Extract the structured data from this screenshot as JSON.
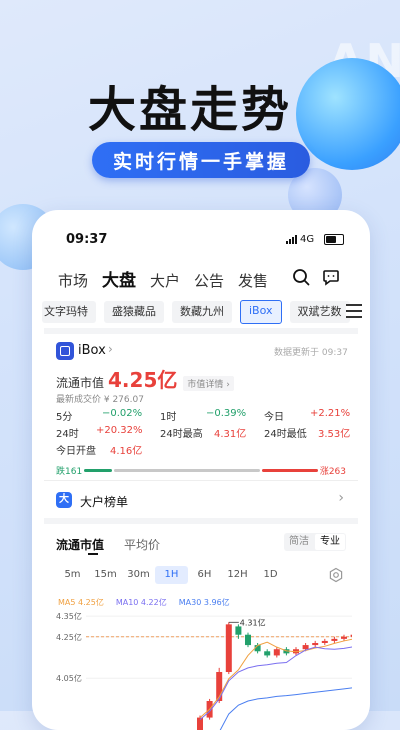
{
  "promo": {
    "headline": "大盘走势",
    "subhead": "实时行情一手掌握",
    "watermark": "AN"
  },
  "status_bar": {
    "time": "09:37",
    "network": "4G"
  },
  "top_nav": {
    "tabs": [
      "市场",
      "大盘",
      "大户",
      "公告",
      "发售"
    ],
    "active": "大盘",
    "icons": [
      "search-icon",
      "message-icon"
    ]
  },
  "platform_chips": {
    "items": [
      "文字玛特",
      "盛猿藏品",
      "数藏九州",
      "iBox",
      "双斌艺数"
    ],
    "active": "iBox",
    "menu_icon": "menu-icon"
  },
  "asset": {
    "name": "iBox",
    "updated": "数据更新于 09:37",
    "market_cap_label": "流通市值",
    "market_cap_value": "4.25亿",
    "market_cap_link": "市值详情",
    "last_price": "最新成交价 ¥ 276.07",
    "stats": [
      {
        "label": "5分",
        "value": "−0.02%",
        "tone": "green"
      },
      {
        "label": "1时",
        "value": "−0.39%",
        "tone": "green"
      },
      {
        "label": "今日",
        "value": "+2.21%",
        "tone": "red"
      },
      {
        "label": "24时",
        "value": "+20.32%",
        "tone": "red"
      },
      {
        "label": "24时最高",
        "value": "4.31亿",
        "tone": "red"
      },
      {
        "label": "24时最低",
        "value": "3.53亿",
        "tone": "red"
      },
      {
        "label": "今日开盘",
        "value": "4.16亿",
        "tone": "red"
      }
    ]
  },
  "up_down": {
    "down_label": "跌161",
    "up_label": "涨263",
    "down_count": 161,
    "up_count": 263,
    "down_color": "#22a06b",
    "up_color": "#e8413b"
  },
  "rank_entry": {
    "icon": "大",
    "label": "大户榜单"
  },
  "chart_tabs": {
    "items": [
      "流通市值",
      "平均价"
    ],
    "active": "流通市值",
    "modes": [
      "简洁",
      "专业"
    ],
    "active_mode": "专业"
  },
  "timeframes": {
    "items": [
      "5m",
      "15m",
      "30m",
      "1H",
      "6H",
      "12H",
      "1D"
    ],
    "active": "1H"
  },
  "chart_data": {
    "type": "candlestick",
    "legend": [
      {
        "label": "MA5 4.25亿",
        "color": "#f0a040"
      },
      {
        "label": "MA10 4.22亿",
        "color": "#7a6ff0"
      },
      {
        "label": "MA30 3.96亿",
        "color": "#4a7ef0"
      }
    ],
    "y_ticks": [
      "4.35亿",
      "4.25亿",
      "4.05亿"
    ],
    "y_tick_values": [
      4.35,
      4.25,
      4.05
    ],
    "current_value": 4.25,
    "high_annotation": "4.31亿",
    "ylim": [
      3.8,
      4.36
    ],
    "candles": [
      {
        "o": 3.8,
        "c": 3.86,
        "h": 3.87,
        "l": 3.79
      },
      {
        "o": 3.86,
        "c": 3.94,
        "h": 3.95,
        "l": 3.85
      },
      {
        "o": 3.94,
        "c": 4.08,
        "h": 4.1,
        "l": 3.93
      },
      {
        "o": 4.08,
        "c": 4.31,
        "h": 4.32,
        "l": 4.07
      },
      {
        "o": 4.3,
        "c": 4.26,
        "h": 4.31,
        "l": 4.24
      },
      {
        "o": 4.26,
        "c": 4.21,
        "h": 4.27,
        "l": 4.2
      },
      {
        "o": 4.21,
        "c": 4.18,
        "h": 4.22,
        "l": 4.17
      },
      {
        "o": 4.18,
        "c": 4.16,
        "h": 4.19,
        "l": 4.15
      },
      {
        "o": 4.16,
        "c": 4.19,
        "h": 4.2,
        "l": 4.15
      },
      {
        "o": 4.19,
        "c": 4.17,
        "h": 4.2,
        "l": 4.16
      },
      {
        "o": 4.17,
        "c": 4.19,
        "h": 4.2,
        "l": 4.16
      },
      {
        "o": 4.19,
        "c": 4.21,
        "h": 4.22,
        "l": 4.18
      },
      {
        "o": 4.21,
        "c": 4.22,
        "h": 4.23,
        "l": 4.2
      },
      {
        "o": 4.22,
        "c": 4.23,
        "h": 4.24,
        "l": 4.21
      },
      {
        "o": 4.23,
        "c": 4.24,
        "h": 4.25,
        "l": 4.22
      },
      {
        "o": 4.24,
        "c": 4.25,
        "h": 4.26,
        "l": 4.23
      },
      {
        "o": 4.25,
        "c": 4.26,
        "h": 4.27,
        "l": 4.24
      },
      {
        "o": 4.26,
        "c": 4.25,
        "h": 4.27,
        "l": 4.24
      }
    ]
  }
}
